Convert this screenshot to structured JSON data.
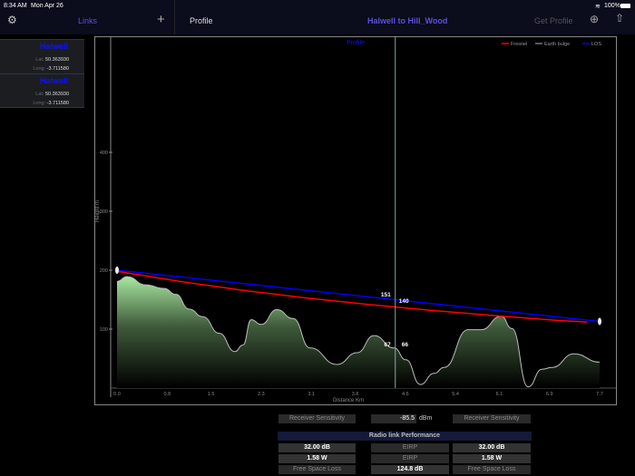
{
  "status": {
    "time": "8:34 AM",
    "date": "Mon Apr 26",
    "battery": "100%"
  },
  "sidebar": {
    "title": "Links",
    "add_icon": "plus-icon",
    "settings_icon": "gear-icon",
    "items": [
      {
        "name": "Halwell",
        "lat_label": "Lat:",
        "lat": "50.363930",
        "long_label": "Long:",
        "long": "-3.711580"
      },
      {
        "name": "Halwell",
        "lat_label": "Lat:",
        "lat": "50.363930",
        "long_label": "Long:",
        "long": "-3.711580"
      }
    ]
  },
  "header": {
    "back_label": "Profile",
    "title": "Halwell to Hill_Wood",
    "get_profile": "Get Profile"
  },
  "colors": {
    "accent": "#5a50e0",
    "fresnel": "#ff0000",
    "los": "#0000ff",
    "terrain": "#a8e6a0"
  },
  "chart_data": {
    "type": "area",
    "title": "Profile",
    "xlabel": "Distance Km",
    "ylabel": "Height m",
    "xlim": [
      0,
      7.7
    ],
    "ylim": [
      0,
      500
    ],
    "x_ticks": [
      "0.0",
      "0.8",
      "1.5",
      "2.3",
      "3.1",
      "3.8",
      "4.6",
      "5.4",
      "6.1",
      "6.9",
      "7.7"
    ],
    "y_ticks": [
      100,
      200,
      300,
      400
    ],
    "legend": [
      {
        "name": "Fresnel",
        "color": "#ff0000"
      },
      {
        "name": "Earth bulge",
        "color": "#777777"
      },
      {
        "name": "LOS",
        "color": "#0000ff"
      }
    ],
    "legend_position": "top-right",
    "terrain": {
      "x": [
        0,
        0.16,
        0.46,
        0.75,
        0.94,
        1.15,
        1.37,
        1.63,
        1.88,
        2.01,
        2.14,
        2.3,
        2.55,
        2.81,
        3.08,
        3.51,
        3.83,
        4.1,
        4.42,
        4.61,
        4.84,
        5.06,
        5.22,
        5.6,
        5.81,
        6.13,
        6.3,
        6.56,
        6.78,
        6.94,
        7.29,
        7.7
      ],
      "y": [
        181,
        189,
        175,
        169,
        159,
        134,
        121,
        93,
        62,
        73,
        116,
        108,
        133,
        118,
        68,
        40,
        60,
        89,
        68,
        48,
        6,
        25,
        35,
        99,
        99,
        122,
        101,
        2,
        32,
        35,
        58,
        44
      ]
    },
    "los": {
      "x": [
        0,
        7.7
      ],
      "y": [
        200,
        113
      ]
    },
    "fresnel": {
      "x": [
        0,
        1,
        2,
        3,
        4,
        5,
        6,
        7,
        7.5
      ],
      "y": [
        198,
        181,
        166,
        153,
        142,
        132,
        123,
        115,
        112
      ]
    },
    "cursor": {
      "x": 4.44,
      "labels": [
        "151",
        "140",
        "67",
        "66"
      ]
    }
  },
  "performance": {
    "sensitivity_label": "Receiver Sensitivity",
    "sensitivity_value": "-85.5",
    "sensitivity_unit": "dBm",
    "title": "Radio link Performance",
    "rows": [
      [
        "32.00 dB",
        "EIRP",
        "32.00 dB"
      ],
      [
        "1.58 W",
        "EIRP",
        "1.58 W"
      ],
      [
        "Free Space Loss",
        "124.8 dB",
        "Free Space Loss"
      ]
    ]
  }
}
